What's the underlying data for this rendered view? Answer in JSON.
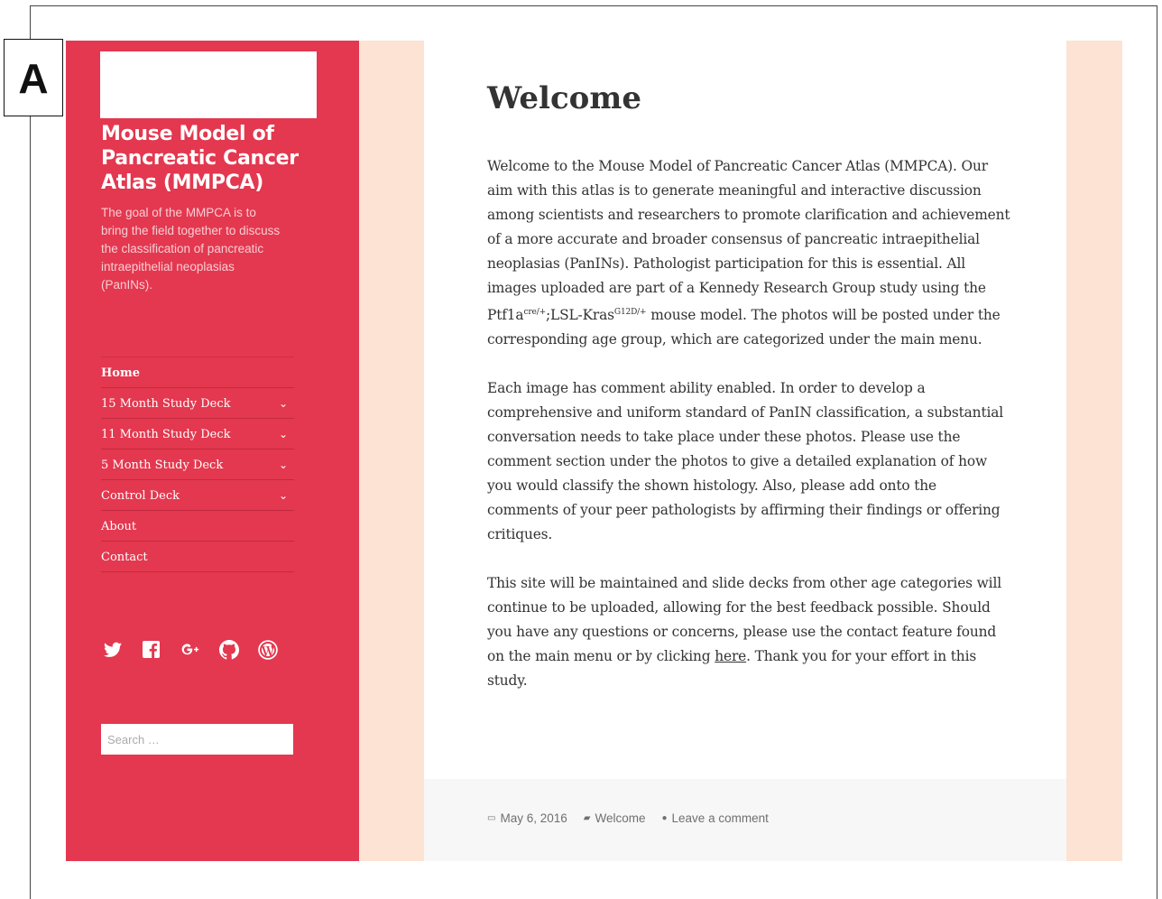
{
  "panel_label": "A",
  "site": {
    "title": "Mouse Model of Pancreatic Cancer Atlas (MMPCA)",
    "description": "The goal of the MMPCA is to bring the field together to discuss the classification of pancreatic intraepithelial neoplasias (PanINs)."
  },
  "nav": {
    "items": [
      {
        "label": "Home",
        "current": true,
        "has_submenu": false
      },
      {
        "label": "15 Month Study Deck",
        "current": false,
        "has_submenu": true
      },
      {
        "label": "11 Month Study Deck",
        "current": false,
        "has_submenu": true
      },
      {
        "label": "5 Month Study Deck",
        "current": false,
        "has_submenu": true
      },
      {
        "label": "Control Deck",
        "current": false,
        "has_submenu": true
      },
      {
        "label": "About",
        "current": false,
        "has_submenu": false
      },
      {
        "label": "Contact",
        "current": false,
        "has_submenu": false
      }
    ],
    "submenu_glyph": "⌄"
  },
  "social": [
    "twitter-icon",
    "facebook-icon",
    "google-plus-icon",
    "github-icon",
    "wordpress-icon"
  ],
  "search": {
    "placeholder": "Search …"
  },
  "article": {
    "title": "Welcome",
    "p1_before_sup1": "Welcome to the Mouse Model of Pancreatic Cancer Atlas (MMPCA). Our aim with this atlas is to generate meaningful and interactive discussion among scientists and researchers to promote clarification and achievement of a more accurate and broader consensus of pancreatic intraepithelial neoplasias (PanINs). Pathologist participation for this is essential. All images uploaded are part of a Kennedy Research Group study using the Ptf1a",
    "p1_sup1": "cre/+",
    "p1_between": ";LSL-Kras",
    "p1_sup2": "G12D/+",
    "p1_after": " mouse model. The photos will be posted under the corresponding age group, which are categorized under the main menu.",
    "p2": "Each image has comment ability enabled. In order to develop a comprehensive and uniform standard of PanIN classification, a substantial conversation needs to take place under these photos. Please use the comment section under the photos to give a detailed explanation of how you would classify the shown histology. Also, please add onto the comments of your peer pathologists by affirming their findings or offering critiques.",
    "p3_before_link": "This site will be maintained and slide decks from other age categories will continue to be uploaded, allowing for the best feedback possible. Should you have any questions or concerns, please use the contact feature found on the main menu or by clicking ",
    "p3_link": "here",
    "p3_after_link": ". Thank you for your effort in this study."
  },
  "footer": {
    "date": "May 6, 2016",
    "category": "Welcome",
    "comment_link": "Leave a comment"
  },
  "colors": {
    "sidebar": "#e3384f",
    "page_background": "#fde3d3",
    "article_background": "#ffffff",
    "footer_background": "#f7f7f7"
  }
}
